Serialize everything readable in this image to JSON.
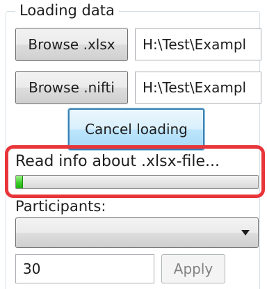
{
  "group": {
    "title": "Loading data"
  },
  "xlsx": {
    "button_label": "Browse .xlsx",
    "path": "H:\\Test\\Exampl"
  },
  "nifti": {
    "button_label": "Browse .nifti",
    "path": "H:\\Test\\Exampl"
  },
  "cancel": {
    "label": "Cancel loading"
  },
  "status": {
    "text": "Read info about .xlsx-file...",
    "progress_fraction": 0.03
  },
  "participants": {
    "label": "Participants:",
    "selected": ""
  },
  "count": {
    "value": "30"
  },
  "apply": {
    "label": "Apply",
    "enabled": false
  },
  "colors": {
    "highlight": "#e8353a",
    "progress": "#3fce2c",
    "focus_border": "#3c7fb1"
  }
}
